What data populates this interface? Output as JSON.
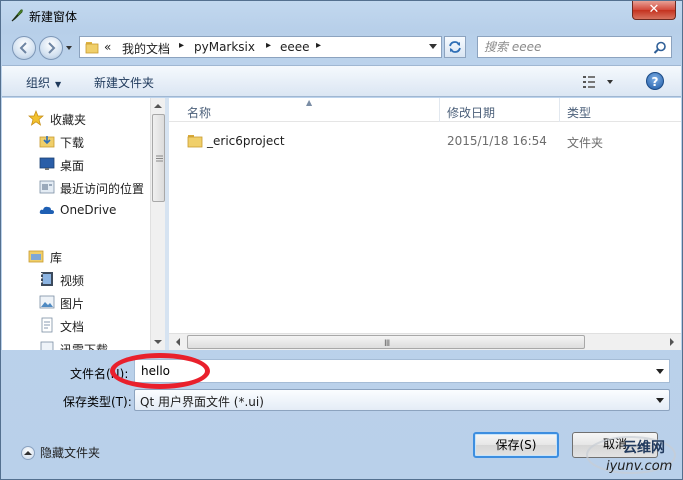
{
  "window": {
    "title": "新建窗体",
    "close_label": "✕"
  },
  "address_bar": {
    "overflow_marker": "«",
    "crumbs": [
      "我的文档",
      "pyMarksix",
      "eeee"
    ],
    "separator": "▸"
  },
  "search": {
    "placeholder": "搜索 eeee"
  },
  "toolbar": {
    "organize_label": "组织",
    "new_folder_label": "新建文件夹",
    "help_label": "?"
  },
  "nav_pane": {
    "favorites": {
      "label": "收藏夹",
      "items": [
        {
          "label": "下载",
          "icon": "download-folder-icon"
        },
        {
          "label": "桌面",
          "icon": "desktop-icon"
        },
        {
          "label": "最近访问的位置",
          "icon": "recent-places-icon"
        },
        {
          "label": "OneDrive",
          "icon": "onedrive-cloud-icon"
        }
      ]
    },
    "libraries": {
      "label": "库",
      "items": [
        {
          "label": "视频",
          "icon": "video-icon"
        },
        {
          "label": "图片",
          "icon": "pictures-icon"
        },
        {
          "label": "文档",
          "icon": "documents-icon"
        },
        {
          "label": "迅雷下载",
          "icon": "thunder-download-icon"
        }
      ]
    }
  },
  "file_list": {
    "columns": [
      "名称",
      "修改日期",
      "类型"
    ],
    "rows": [
      {
        "name": "_eric6project",
        "modified": "2015/1/18 16:54",
        "type": "文件夹"
      }
    ],
    "hscroll_grip": "Ⅲ"
  },
  "form": {
    "filename_label": "文件名(N):",
    "filename_value": "hello",
    "filetype_label": "保存类型(T):",
    "filetype_value": "Qt 用户界面文件 (*.ui)"
  },
  "footer": {
    "hide_folders_label": "隐藏文件夹",
    "save_label": "保存(S)",
    "cancel_label": "取消"
  },
  "watermark": {
    "line1": "云维网",
    "line2": "iyunv.com"
  },
  "colors": {
    "annotation_red": "#e9202c",
    "folder_yellow": "#e8c35a",
    "frame_blue": "#b9d0ea"
  }
}
